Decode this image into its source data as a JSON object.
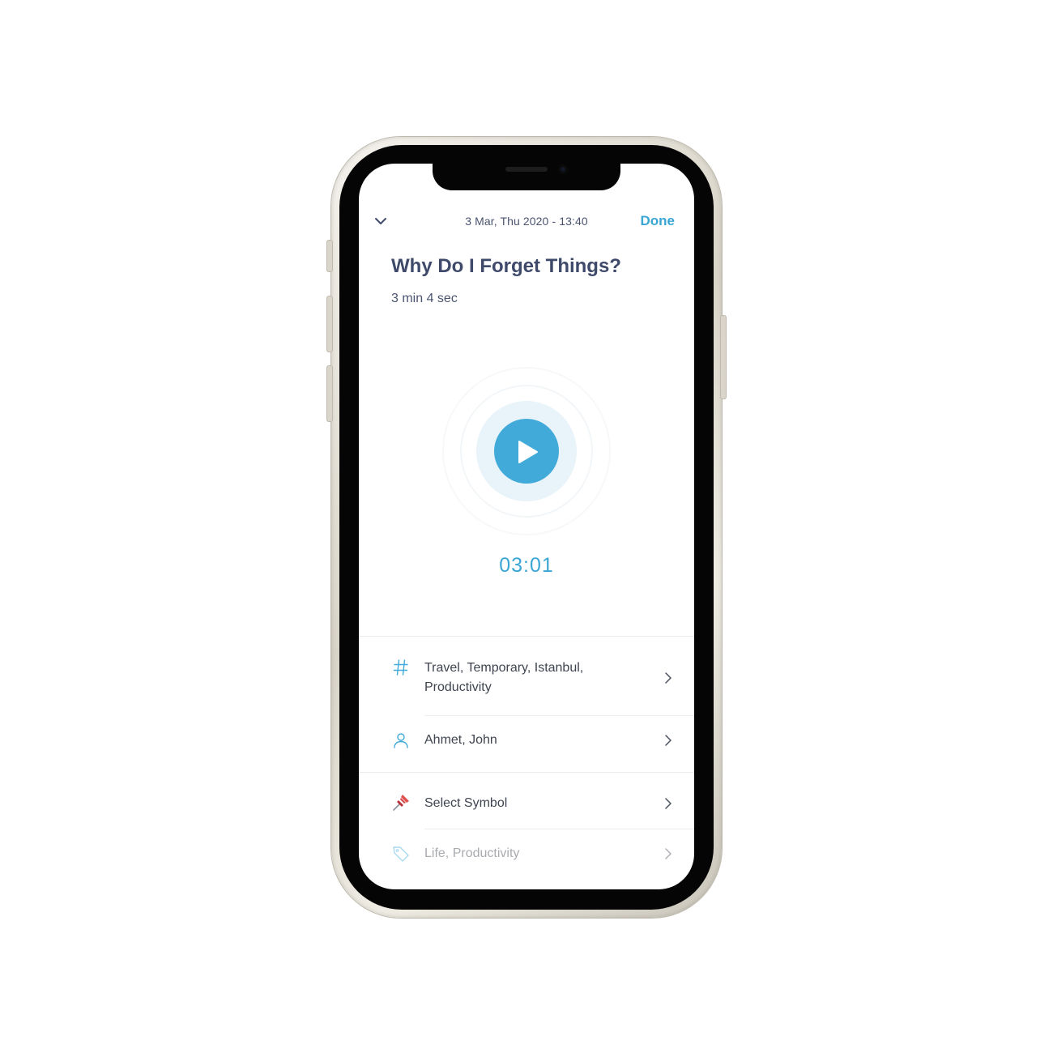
{
  "header": {
    "datetime": "3 Mar, Thu 2020 - 13:40",
    "done_label": "Done"
  },
  "note": {
    "title": "Why Do I Forget Things?",
    "duration": "3 min 4 sec"
  },
  "player": {
    "elapsed": "03:01"
  },
  "details": {
    "hashtags": "Travel, Temporary, Istanbul, Productivity",
    "people": "Ahmet, John",
    "symbol": "Select Symbol",
    "tags": "Life, Productivity"
  },
  "icons": {
    "collapse": "chevron-down-icon",
    "play": "play-icon",
    "hashtags": "hashtag-icon",
    "people": "person-icon",
    "symbol": "pushpin-icon",
    "tags": "tag-icon",
    "disclosure": "chevron-right-icon"
  },
  "colors": {
    "accent": "#42aad9",
    "title": "#3f4a6b",
    "text": "#3f4450",
    "pin": "#d64545"
  }
}
